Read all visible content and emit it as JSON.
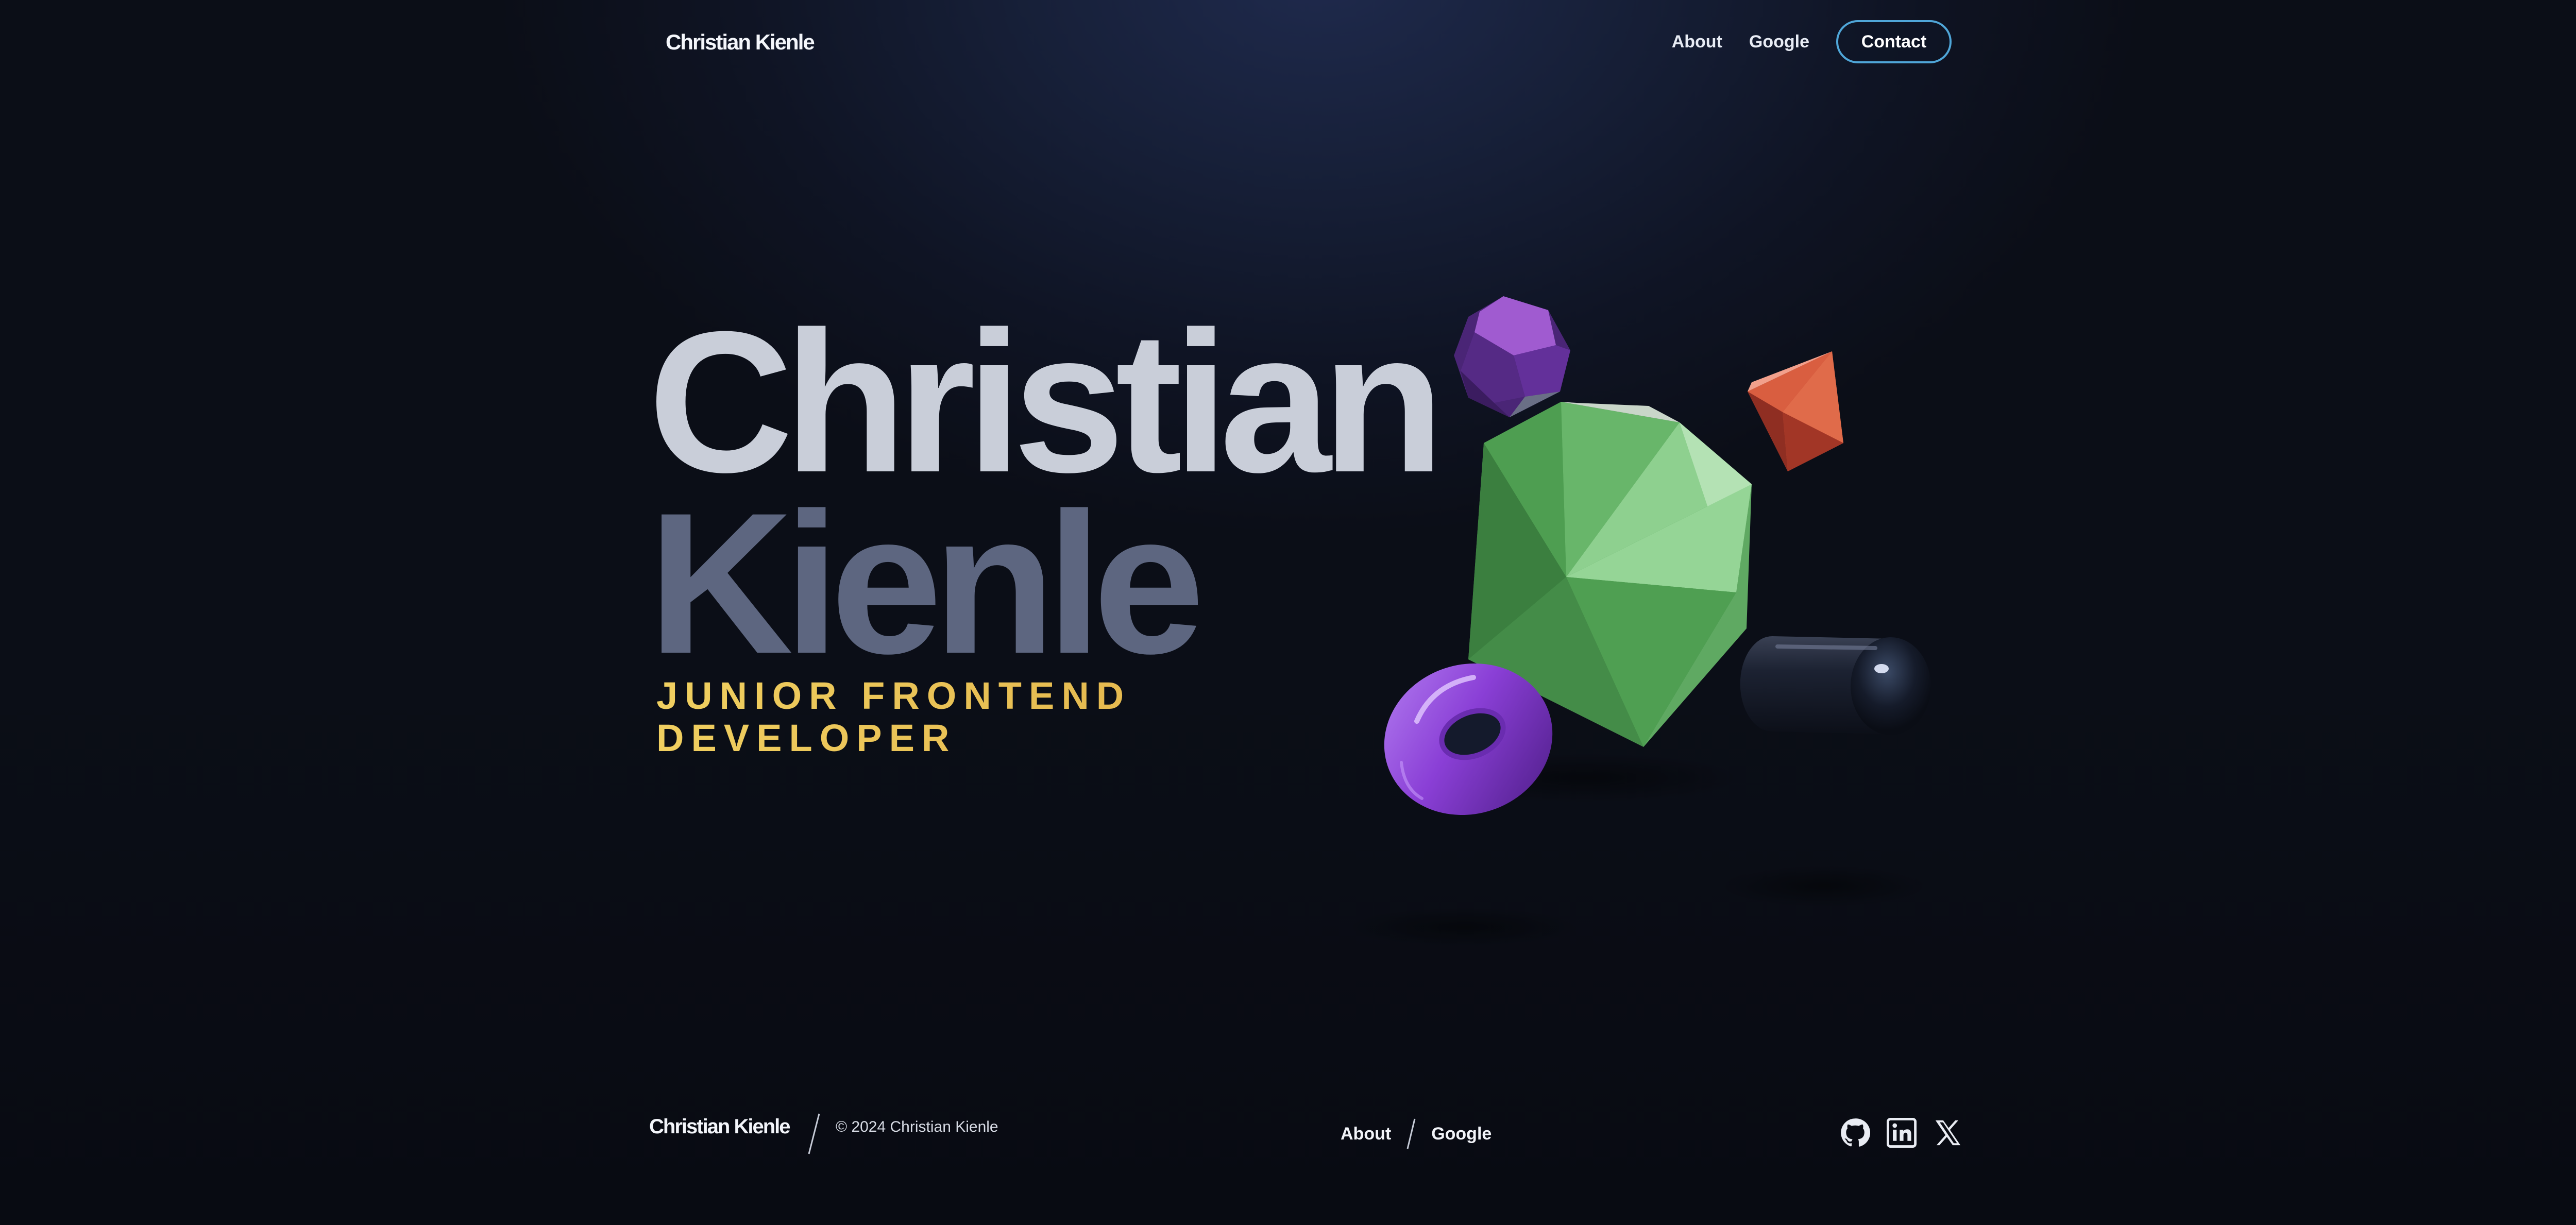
{
  "header": {
    "brand": "Christian Kienle",
    "nav": [
      {
        "label": "About"
      },
      {
        "label": "Google"
      }
    ],
    "contact_label": "Contact"
  },
  "hero": {
    "first_name": "Christian",
    "last_name": "Kienle",
    "role_line1": "JUNIOR FRONTEND",
    "role_line2": "DEVELOPER"
  },
  "shapes": {
    "items": [
      {
        "name": "green-icosahedron",
        "color": "#5aa65c"
      },
      {
        "name": "purple-dodecahedron",
        "color": "#7a3db3"
      },
      {
        "name": "orange-octahedron",
        "color": "#d9603e"
      },
      {
        "name": "purple-torus",
        "color": "#8a3fd6"
      },
      {
        "name": "black-capsule",
        "color": "#1b2232"
      }
    ]
  },
  "footer": {
    "brand": "Christian Kienle",
    "copyright": "© 2024 Christian Kienle",
    "nav": [
      {
        "label": "About"
      },
      {
        "label": "Google"
      }
    ],
    "socials": [
      {
        "icon": "github-icon"
      },
      {
        "icon": "linkedin-icon"
      },
      {
        "icon": "x-icon"
      }
    ]
  },
  "colors": {
    "accent": "#4fa6d8",
    "role_gold": "#e9c75a",
    "first_name": "#c9ced9",
    "last_name": "#5d6680",
    "background": "#0b0e17"
  }
}
